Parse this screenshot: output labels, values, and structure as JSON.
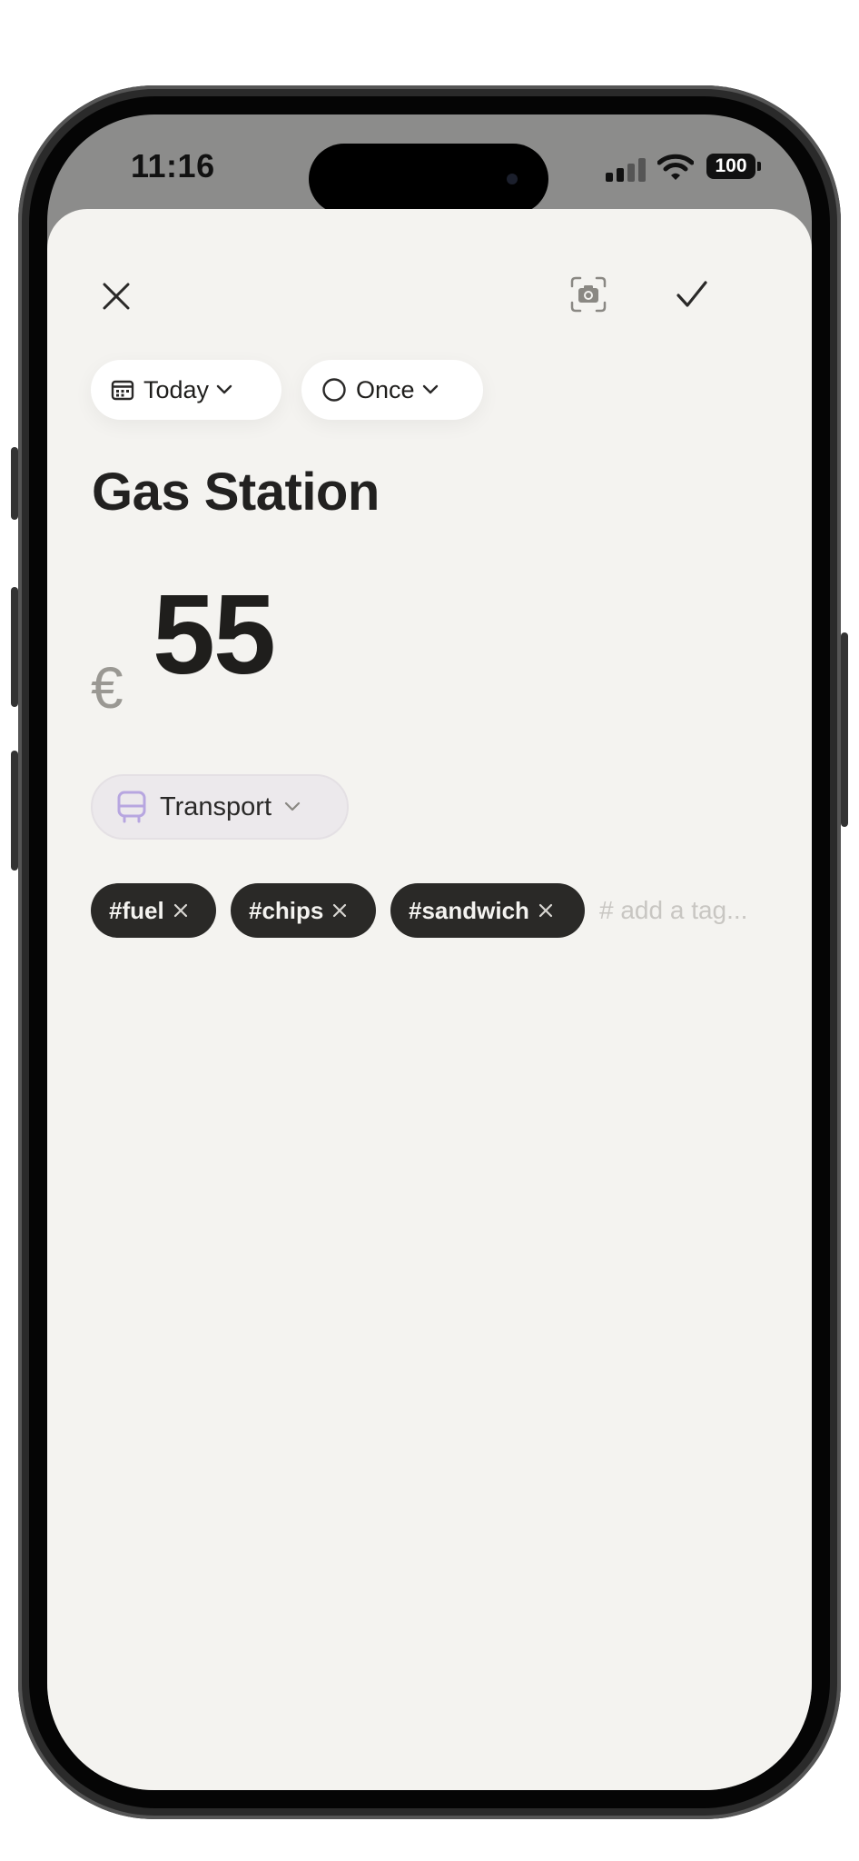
{
  "status_bar": {
    "time": "11:16",
    "battery": "100"
  },
  "toolbar": {
    "close_icon": "close-icon",
    "camera_icon": "camera-scan-icon",
    "confirm_icon": "checkmark-icon"
  },
  "date_selector": {
    "icon": "calendar-icon",
    "label": "Today"
  },
  "repeat_selector": {
    "icon": "circle-icon",
    "label": "Once"
  },
  "transaction": {
    "title": "Gas Station",
    "currency_symbol": "€",
    "amount": "55"
  },
  "category": {
    "icon": "bus-icon",
    "label": "Transport",
    "color": "#b7a6e0"
  },
  "tags": {
    "items": [
      {
        "label": "#fuel"
      },
      {
        "label": "#chips"
      },
      {
        "label": "#sandwich"
      }
    ],
    "placeholder": "# add a tag..."
  },
  "colors": {
    "sheet_background": "#f4f3f0",
    "tag_background": "#2a2927",
    "text_primary": "#1f1e1c",
    "currency_gray": "#9a9893"
  }
}
